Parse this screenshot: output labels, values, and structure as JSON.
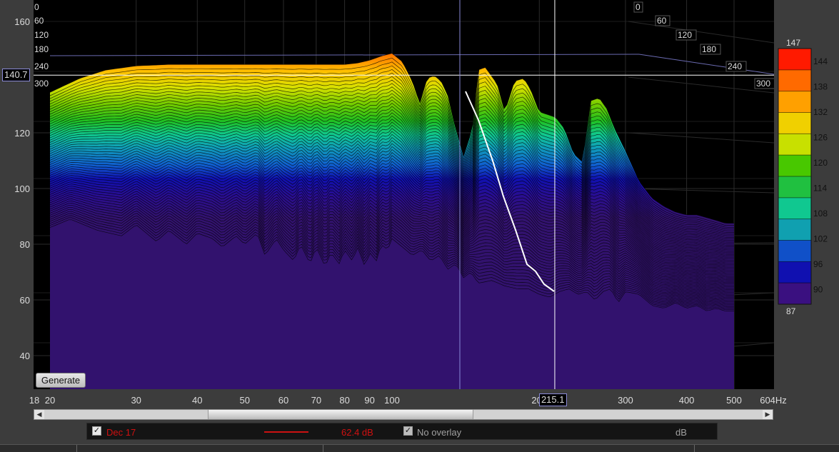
{
  "colors": {
    "plot_bg": "#000000",
    "floor_purple": "#32126e",
    "cursor": "#ffffff",
    "overlay_line": "#cc1111",
    "grid": "#3a3a3a"
  },
  "chart_data": {
    "type": "waterfall",
    "x_unit": "Hz",
    "x_ticks": [
      "18",
      "20",
      "30",
      "40",
      "50",
      "60",
      "70",
      "80",
      "90",
      "100",
      "200",
      "300",
      "400",
      "500",
      "604Hz"
    ],
    "x_tick_values": [
      18,
      20,
      30,
      40,
      50,
      60,
      70,
      80,
      90,
      100,
      200,
      300,
      400,
      500,
      604
    ],
    "xlim": [
      18,
      604
    ],
    "x_scale": "log",
    "y_ticks": [
      "160",
      "120",
      "100",
      "80",
      "60",
      "40"
    ],
    "y_tick_values": [
      160,
      120,
      100,
      80,
      60,
      40
    ],
    "ylim": [
      30,
      165
    ],
    "time_ticks_left": [
      "0",
      "60",
      "120",
      "180",
      "240",
      "300"
    ],
    "time_ticks_right": [
      "0",
      "60",
      "120",
      "180",
      "240",
      "300"
    ],
    "color_scale": {
      "labels": [
        "147",
        "144",
        "138",
        "132",
        "126",
        "120",
        "114",
        "108",
        "102",
        "96",
        "90",
        "87"
      ],
      "min": 87,
      "max": 147,
      "colors": [
        "#ff1a00",
        "#ff6a00",
        "#ffa000",
        "#f0d000",
        "#c8e000",
        "#48c800",
        "#20c040",
        "#10c890",
        "#10a0b0",
        "#1050c8",
        "#1010b0",
        "#3a1080"
      ]
    },
    "front_curve": {
      "freqs": [
        20,
        22,
        25,
        28,
        30,
        33,
        35,
        38,
        40,
        43,
        45,
        48,
        50,
        53,
        55,
        58,
        60,
        63,
        65,
        68,
        70,
        73,
        75,
        78,
        80,
        83,
        85,
        88,
        90,
        93,
        95,
        98,
        100,
        105,
        110,
        115,
        120,
        125,
        130,
        135,
        140,
        145,
        150,
        160,
        170,
        180,
        190,
        200,
        210,
        220,
        230,
        240,
        250,
        260,
        270,
        280,
        290,
        300,
        320,
        340,
        360,
        380,
        400,
        420,
        440,
        460,
        480,
        500
      ],
      "spl": [
        86,
        89,
        85,
        83,
        87,
        81,
        85,
        80,
        84,
        82,
        79,
        83,
        80,
        84,
        76,
        82,
        78,
        74,
        80,
        73,
        79,
        72,
        77,
        73,
        78,
        74,
        79,
        72,
        77,
        74,
        80,
        78,
        82,
        79,
        76,
        78,
        74,
        76,
        71,
        73,
        68,
        70,
        66,
        67,
        65,
        64,
        64,
        62,
        61,
        63,
        64,
        62,
        63,
        60,
        63,
        64,
        59,
        63,
        62,
        58,
        57,
        59,
        57,
        58,
        56,
        57,
        56,
        56
      ]
    },
    "back_curve": {
      "freqs": [
        20,
        23,
        26,
        30,
        35,
        40,
        45,
        50,
        55,
        60,
        65,
        70,
        75,
        80,
        85,
        90,
        95,
        100,
        105,
        110,
        114,
        118,
        122,
        126,
        130,
        134,
        140,
        146,
        150,
        155,
        158,
        164,
        170,
        178,
        186,
        192,
        200,
        208,
        216,
        225,
        235,
        245,
        255,
        265,
        275,
        285,
        300,
        320,
        340,
        360,
        380,
        400,
        420,
        440,
        460,
        480,
        500
      ],
      "spl": [
        133,
        138,
        141,
        142.5,
        143,
        143,
        143,
        143,
        143,
        143,
        143,
        143,
        143,
        143,
        143.5,
        144.5,
        146,
        147,
        144,
        137,
        129,
        138,
        139,
        137,
        132,
        122,
        110,
        120,
        141,
        142,
        140,
        136,
        126,
        137,
        138,
        134,
        126,
        125,
        124,
        120,
        111,
        108,
        130,
        131,
        127,
        120,
        112,
        101,
        95,
        92,
        90,
        89,
        89,
        88,
        87,
        86,
        86
      ]
    },
    "cursor": {
      "x_readout": "215.1",
      "y_readout": "140.7"
    }
  },
  "controls": {
    "generate_label": "Generate"
  },
  "legend": {
    "series_name": "Dec 17",
    "series_value": "62.4 dB",
    "overlay_label": "No overlay",
    "unit": "dB",
    "series_color": "#cc1111"
  }
}
